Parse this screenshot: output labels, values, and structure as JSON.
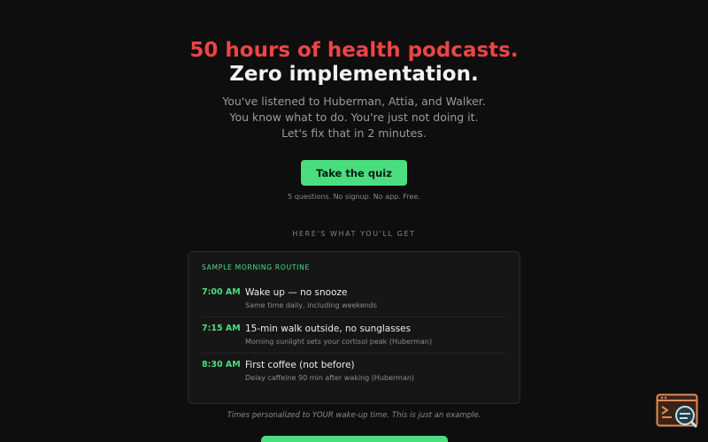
{
  "hero": {
    "headline_accent": "50 hours of health podcasts.",
    "headline_main": "Zero implementation.",
    "subtitle": "You've listened to Huberman, Attia, and Walker. You know what to do. You're just not doing it. Let's fix that in 2 minutes."
  },
  "cta": {
    "label": "Take the quiz",
    "note": "5 questions. No signup. No app. Free."
  },
  "preview": {
    "section_label": "HERE'S WHAT YOU'LL GET",
    "card_label": "SAMPLE MORNING ROUTINE",
    "items": [
      {
        "time": "7:00 AM",
        "title": "Wake up — no snooze",
        "desc": "Same time daily, including weekends"
      },
      {
        "time": "7:15 AM",
        "title": "15-min walk outside, no sunglasses",
        "desc": "Morning sunlight sets your cortisol peak (Huberman)"
      },
      {
        "time": "8:30 AM",
        "title": "First coffee (not before)",
        "desc": "Delay caffeine 90 min after waking (Huberman)"
      }
    ],
    "footnote": "Times personalized to YOUR wake-up time. This is just an example."
  },
  "colors": {
    "accent_green": "#4ade80",
    "accent_red": "#ef4444",
    "background": "#0e0e0e",
    "card": "#161616"
  },
  "icons": {
    "corner_widget": "browser-search-icon"
  }
}
